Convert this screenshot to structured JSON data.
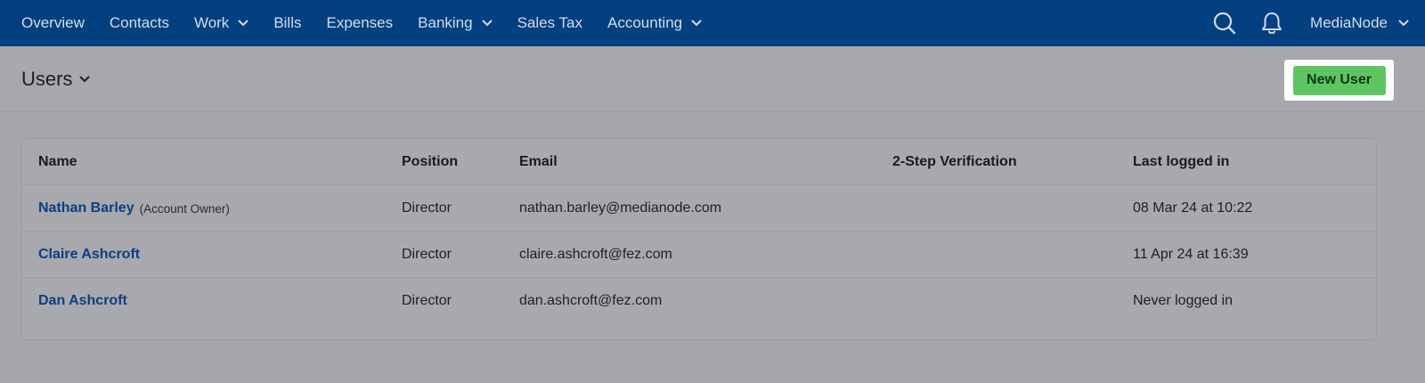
{
  "nav": {
    "items": [
      {
        "label": "Overview",
        "has_dropdown": false
      },
      {
        "label": "Contacts",
        "has_dropdown": false
      },
      {
        "label": "Work",
        "has_dropdown": true
      },
      {
        "label": "Bills",
        "has_dropdown": false
      },
      {
        "label": "Expenses",
        "has_dropdown": false
      },
      {
        "label": "Banking",
        "has_dropdown": true
      },
      {
        "label": "Sales Tax",
        "has_dropdown": false
      },
      {
        "label": "Accounting",
        "has_dropdown": true
      }
    ],
    "search_icon": "search-icon",
    "notifications_icon": "bell-icon",
    "account_label": "MediaNode"
  },
  "page": {
    "title": "Users",
    "new_user_label": "New User"
  },
  "table": {
    "headers": {
      "name": "Name",
      "position": "Position",
      "email": "Email",
      "two_step": "2-Step Verification",
      "last_logged_in": "Last logged in"
    },
    "rows": [
      {
        "name": "Nathan Barley",
        "note": "(Account Owner)",
        "position": "Director",
        "email": "nathan.barley@medianode.com",
        "two_step": "",
        "last_logged_in": "08 Mar 24 at 10:22"
      },
      {
        "name": "Claire Ashcroft",
        "note": "",
        "position": "Director",
        "email": "claire.ashcroft@fez.com",
        "two_step": "",
        "last_logged_in": "11 Apr 24 at 16:39"
      },
      {
        "name": "Dan Ashcroft",
        "note": "",
        "position": "Director",
        "email": "dan.ashcroft@fez.com",
        "two_step": "",
        "last_logged_in": "Never logged in"
      }
    ]
  },
  "colors": {
    "nav_background": "#03407f",
    "primary_button": "#5dc661",
    "link": "#0c3e85"
  }
}
